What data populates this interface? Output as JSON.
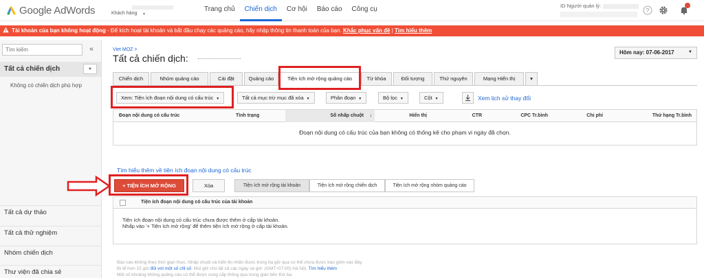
{
  "header": {
    "product_name": "Google AdWords",
    "account_type": "Khách hàng",
    "nav": [
      "Trang chủ",
      "Chiến dịch",
      "Cơ hội",
      "Báo cáo",
      "Công cụ"
    ],
    "active_nav_index": 1,
    "user_id_label": "ID Người quản lý:"
  },
  "alert": {
    "bold_text": "Tài khoản của bạn không hoạt động",
    "text": " - Để kích hoạt tài khoản và bắt đầu chạy các quảng cáo, hãy nhập thông tin thanh toán của bạn. ",
    "fix_link": "Khắc phục vấn đề",
    "separator": " | ",
    "learn_link": "Tìm hiểu thêm"
  },
  "sidebar": {
    "search_placeholder": "Tìm kiếm",
    "collapse_glyph": "«",
    "all_campaigns": "Tất cả chiến dịch",
    "empty_text": "Không có chiến dịch phù hợp",
    "bottom_items": [
      "Tất cả dự thảo",
      "Tất cả thử nghiệm",
      "Nhóm chiến dịch",
      "Thư viện đã chia sẻ"
    ]
  },
  "main": {
    "breadcrumb": "Viet MOZ >",
    "title": "Tất cả chiến dịch: ",
    "date_button": "Hôm nay: 07-06-2017",
    "tabs": [
      "Chiến dịch",
      "Nhóm quảng cáo",
      "Cài đặt",
      "Quảng cáo",
      "Tiện ích mở rộng quảng cáo",
      "Từ khóa",
      "Đối tượng",
      "Thứ nguyên",
      "Mạng Hiển thị"
    ],
    "active_tab_index": 4,
    "more_tabs_glyph": "▾",
    "toolbar": {
      "view_filter": "Xem: Tiện ích đoạn nội dung có cấu trúc",
      "all_but_deleted": "Tất cả mục trừ mục đã xóa",
      "segment": "Phân đoạn",
      "filter": "Bộ lọc",
      "columns": "Cột",
      "history_link": "Xem lịch sử thay đổi"
    },
    "table1": {
      "columns": [
        "Đoạn nội dung có cấu trúc",
        "Tình trạng",
        "Số nhấp chuột",
        "Hiển thị",
        "CTR",
        "CPC Tr.bình",
        "Chi phí",
        "Thứ hạng Tr.bình"
      ],
      "sorted_column_index": 2,
      "empty_message": "Đoạn nội dung có cấu trúc của bạn không có thống kê cho phạm vi ngày đã chọn."
    },
    "learn_more": "Tìm hiểu thêm về tiện ích đoạn nội dung có cấu trúc",
    "add_button": "+ TIỆN ÍCH MỞ RỘNG",
    "delete_button": "Xóa",
    "level_tabs": [
      "Tiện ích mở rộng tài khoản",
      "Tiện ích mở rộng chiến dịch",
      "Tiện ích mở rộng nhóm quảng cáo"
    ],
    "active_level_index": 0,
    "table2": {
      "header": "Tiện ích đoạn nội dung có cấu trúc của tài khoản",
      "message_line1": "Tiện ích đoạn nội dung có cấu trúc chưa được thêm ở cấp tài khoản.",
      "message_line2": "Nhấp vào '+ Tiện ích mở rộng' để thêm tiện ích mở rộng ở cấp tài khoản."
    },
    "footer": {
      "line1": "Báo cáo không theo thời gian thực. Nhấp chuột và hiển thị nhấn được trong ba giờ qua có thể chưa được bao gồm vào đây.",
      "line2_text": "Đi tể hơn 15 giờ ",
      "line2_link1": "đối với một số chỉ số",
      "line2_mid": ". Múi giờ cho tất cả các ngày và giờ: (GMT+07:00) Hà Nội. ",
      "line2_link2": "Tìm hiểu thêm",
      "line3": "Một số khoảng không quảng cáo có thể được cung cấp thông qua trung gian bên thứ ba."
    }
  },
  "colors": {
    "accent_blue": "#1a65d6",
    "alert_red": "#f04e36",
    "add_button_red": "#dd4b39",
    "highlight_red": "#e02020"
  }
}
